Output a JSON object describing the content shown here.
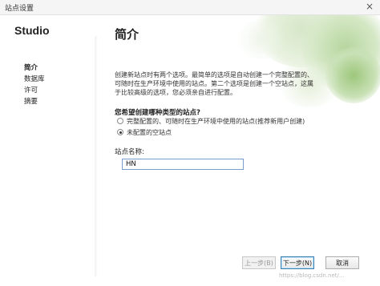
{
  "window": {
    "title": "站点设置",
    "close_glyph": "×"
  },
  "sidebar": {
    "brand": "Studio",
    "items": [
      {
        "label": "简介",
        "active": true
      },
      {
        "label": "数据库",
        "active": false
      },
      {
        "label": "许可",
        "active": false
      },
      {
        "label": "摘要",
        "active": false
      }
    ]
  },
  "main": {
    "heading": "简介",
    "description": "创建新站点时有两个选项。最简单的选项是自动创建一个完整配置的、可随时在生产环境中使用的站点。第二个选项是创建一个空站点，这属于比较高级的选项，您必须亲自进行配置。",
    "question": "您希望创建哪种类型的站点?",
    "options": [
      {
        "label": "完整配置的、可随时在生产环境中使用的站点(推荐新用户创建)",
        "checked": false
      },
      {
        "label": "未配置的空站点",
        "checked": true
      }
    ],
    "site_name_label": "站点名称:",
    "site_name_value": "HN"
  },
  "footer": {
    "back_label": "上一步(B)",
    "next_label": "下一步(N)",
    "cancel_label": "取消"
  },
  "watermark": "https://blog.csdn.net/...",
  "colors": {
    "accent_green": "#8fbf6a",
    "input_border": "#7a9ccc",
    "primary_border": "#3c7fb1"
  }
}
